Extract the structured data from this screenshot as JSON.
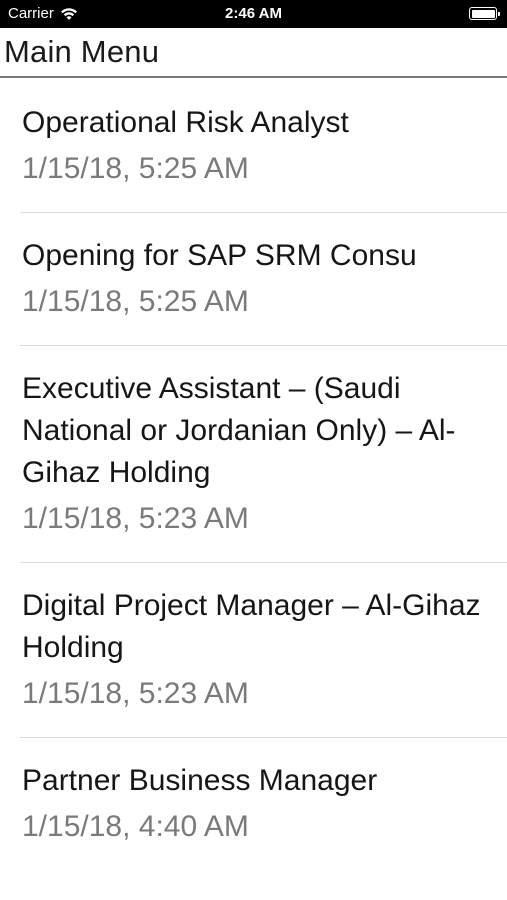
{
  "status_bar": {
    "carrier": "Carrier",
    "time": "2:46 AM"
  },
  "header": {
    "title": "Main Menu"
  },
  "items": [
    {
      "title": "Operational Risk Analyst",
      "date": "1/15/18, 5:25 AM"
    },
    {
      "title": "Opening for SAP SRM Consu",
      "date": "1/15/18, 5:25 AM"
    },
    {
      "title": "Executive Assistant – (Saudi National or Jordanian Only) – Al-Gihaz Holding",
      "date": "1/15/18, 5:23 AM"
    },
    {
      "title": "Digital Project Manager – Al-Gihaz Holding",
      "date": "1/15/18, 5:23 AM"
    },
    {
      "title": "Partner Business Manager",
      "date": "1/15/18, 4:40 AM"
    }
  ],
  "colors": {
    "status_bar_bg": "#000000",
    "date_text": "#7a7a7a",
    "separator": "#dcdcdc"
  }
}
